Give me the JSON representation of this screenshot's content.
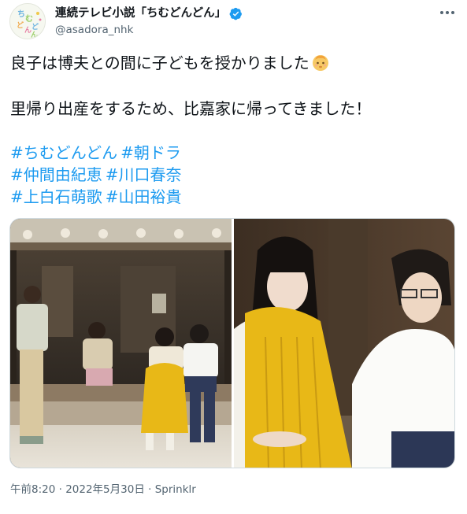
{
  "tweet": {
    "author": {
      "display_name": "連続テレビ小説「ちむどんどん」",
      "handle": "@asadora_nhk",
      "verified": true,
      "avatar_icon": "chimudondon-logo-avatar"
    },
    "more_icon": "more-dots-icon",
    "text": {
      "line1": "良子は博夫との間に子どもを授かりました",
      "line1_emoji": "baby-face-emoji",
      "line2": "里帰り出産をするため、比嘉家に帰ってきました！"
    },
    "hashtags": [
      [
        "#ちむどんどん",
        "#朝ドラ"
      ],
      [
        "#仲間由紀恵",
        "#川口春奈"
      ],
      [
        "#上白石萌歌",
        "#山田裕貴"
      ]
    ],
    "media": {
      "photos": [
        "family-on-porch-photo",
        "couple-closeup-photo"
      ]
    },
    "meta": {
      "time": "午前8:20",
      "separator1": " · ",
      "date": "2022年5月30日",
      "separator2": " · ",
      "source": "Sprinklr"
    }
  },
  "colors": {
    "link": "#1d9bf0",
    "verified": "#1d9bf0",
    "secondary_text": "#536471",
    "dress_yellow": "#e8b817"
  }
}
